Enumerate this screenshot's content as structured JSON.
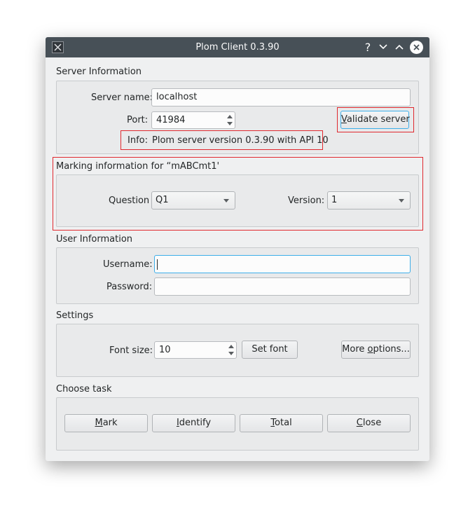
{
  "window": {
    "title": "Plom Client 0.3.90"
  },
  "server": {
    "heading": "Server Information",
    "name_label": "Server name:",
    "name_value": "localhost",
    "port_label": "Port:",
    "port_value": "41984",
    "validate_label_first": "V",
    "validate_label_rest": "alidate server",
    "info_label": "Info:",
    "info_value": "Plom server version 0.3.90 with API 10"
  },
  "marking": {
    "heading": "Marking information for “mABCmt1'",
    "question_label": "Question",
    "question_value": "Q1",
    "version_label": "Version:",
    "version_value": "1"
  },
  "user": {
    "heading": "User Information",
    "username_label": "Username:",
    "username_value": "",
    "password_label": "Password:",
    "password_value": ""
  },
  "settings": {
    "heading": "Settings",
    "font_size_label": "Font size:",
    "font_size_value": "10",
    "set_font_label": "Set font",
    "more_options_pre": "More ",
    "more_options_u": "o",
    "more_options_post": "ptions..."
  },
  "tasks": {
    "heading": "Choose task",
    "mark_u": "M",
    "mark_rest": "ark",
    "identify_u": "I",
    "identify_rest": "dentify",
    "total_u": "T",
    "total_rest": "otal",
    "close_u": "C",
    "close_rest": "lose"
  }
}
